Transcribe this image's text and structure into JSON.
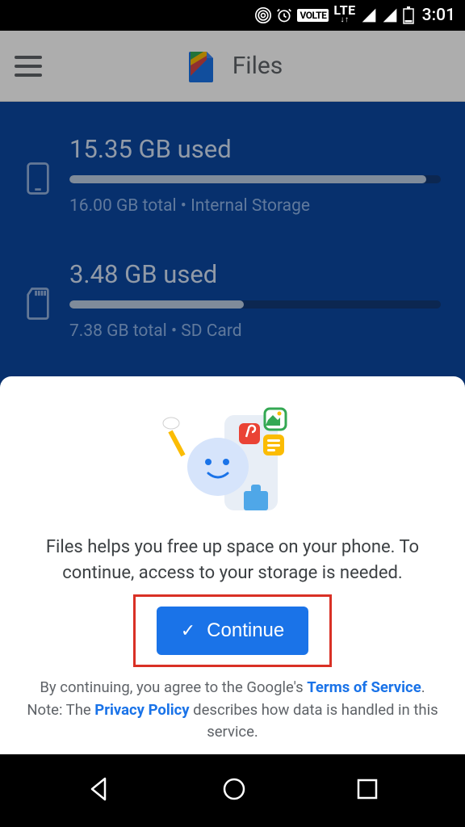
{
  "status": {
    "volte": "VOLTE",
    "lte": "LTE",
    "clock": "3:01"
  },
  "header": {
    "title": "Files"
  },
  "storage": {
    "internal": {
      "used_line": "15.35 GB used",
      "sub_line": "16.00 GB total • Internal Storage",
      "fill_pct": 96
    },
    "sd": {
      "used_line": "3.48 GB used",
      "sub_line": "7.38 GB total • SD Card",
      "fill_pct": 47
    }
  },
  "sheet": {
    "message": "Files helps you free up space on your phone. To continue, access to your storage is needed.",
    "continue_label": "Continue",
    "legal_pre": "By continuing, you agree to the Google's ",
    "tos": "Terms of Service",
    "legal_mid": ". Note: The ",
    "privacy": "Privacy Policy",
    "legal_post": " describes how data is handled in this service."
  }
}
